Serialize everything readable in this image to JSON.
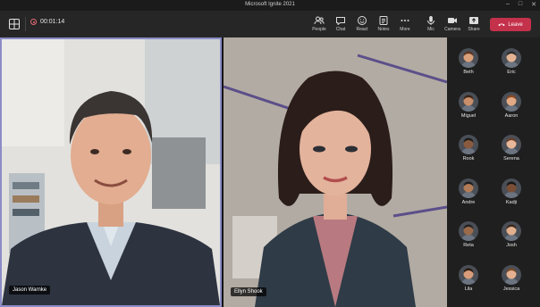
{
  "window": {
    "title": "Microsoft Ignite 2021"
  },
  "toolbar": {
    "timer": "00:01:14",
    "buttons": [
      {
        "label": "People",
        "icon": "people-icon"
      },
      {
        "label": "Chat",
        "icon": "chat-icon"
      },
      {
        "label": "React",
        "icon": "react-icon"
      },
      {
        "label": "Notes",
        "icon": "notes-icon"
      },
      {
        "label": "More",
        "icon": "more-icon"
      }
    ],
    "device_buttons": [
      {
        "label": "Mic",
        "icon": "mic-icon"
      },
      {
        "label": "Camera",
        "icon": "camera-icon"
      },
      {
        "label": "Share",
        "icon": "share-icon"
      }
    ],
    "leave_label": "Leave",
    "leave_color": "#c4314b"
  },
  "tiles": [
    {
      "name": "Jason Warnke",
      "highlight_color": "#8b8cc7"
    },
    {
      "name": "Ellyn Shook"
    }
  ],
  "participants": [
    {
      "name": "Beth",
      "skin": "#d9a07a",
      "hair": "#5a3522"
    },
    {
      "name": "Eric",
      "skin": "#e3b393",
      "hair": "#2c2c2c"
    },
    {
      "name": "Miguel",
      "skin": "#c98e6a",
      "hair": "#3a2418"
    },
    {
      "name": "Aaron",
      "skin": "#e1aa85",
      "hair": "#8a4a25"
    },
    {
      "name": "Rook",
      "skin": "#8a5a3f",
      "hair": "#1c1c1c"
    },
    {
      "name": "Serena",
      "skin": "#e7b79a",
      "hair": "#6b3e2a"
    },
    {
      "name": "Andre",
      "skin": "#b27b57",
      "hair": "#1e1e1e"
    },
    {
      "name": "Kadji",
      "skin": "#7a4e35",
      "hair": "#161616"
    },
    {
      "name": "Reta",
      "skin": "#9a6a4a",
      "hair": "#222222"
    },
    {
      "name": "Josh",
      "skin": "#e2b08e",
      "hair": "#3b2a1d"
    },
    {
      "name": "Lila",
      "skin": "#d99c7a",
      "hair": "#2b1b14"
    },
    {
      "name": "Jessica",
      "skin": "#e5b08f",
      "hair": "#7a4b2a"
    }
  ]
}
